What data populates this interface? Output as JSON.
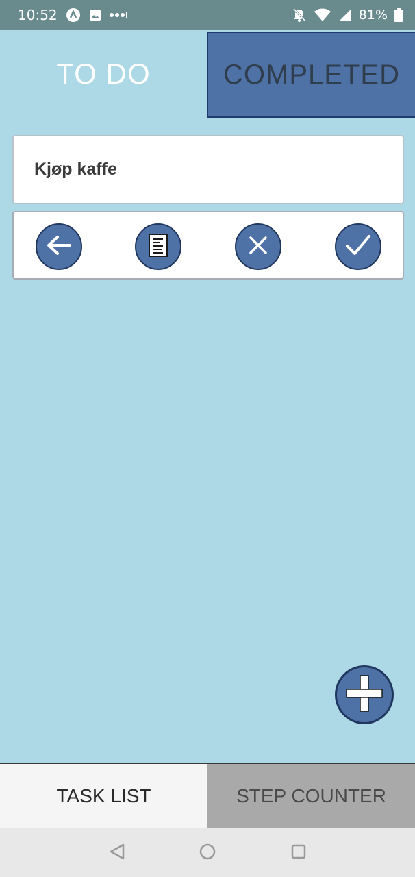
{
  "status_bar": {
    "time": "10:52",
    "battery": "81%",
    "icons_left": [
      "app-icon",
      "image-icon",
      "more-dots-icon"
    ],
    "icons_right": [
      "mute-bell-icon",
      "wifi-icon",
      "signal-icon",
      "battery-icon"
    ]
  },
  "tabs": {
    "todo_label": "TO DO",
    "completed_label": "COMPLETED"
  },
  "task": {
    "title": "Kjøp kaffe"
  },
  "actions": [
    "back-arrow-icon",
    "notes-icon",
    "delete-x-icon",
    "check-icon"
  ],
  "fab": {
    "icon": "plus-icon"
  },
  "bottom_nav": {
    "task_list_label": "TASK LIST",
    "step_counter_label": "STEP COUNTER"
  },
  "system_nav": [
    "back-triangle-icon",
    "home-circle-icon",
    "recents-square-icon"
  ],
  "colors": {
    "background": "#add8e6",
    "status_bar": "#6a8b8e",
    "accent_blue": "#4f72a6",
    "dark_outline": "#21365e"
  }
}
